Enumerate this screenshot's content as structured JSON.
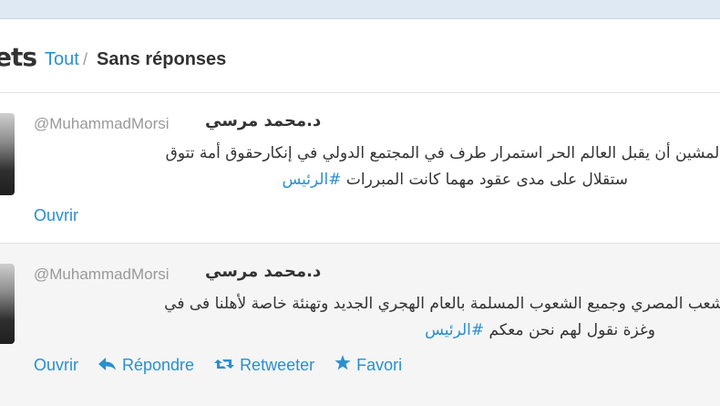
{
  "header": {
    "title_fragment": "ets",
    "tab_all": "Tout",
    "separator": "/",
    "tab_no_replies": "Sans réponses"
  },
  "tweets": [
    {
      "handle": "@MuhammadMorsi",
      "name": "د.محمد مرسي",
      "line1": "المشين أن يقبل العالم الحر استمرار طرف في المجتمع الدولي في إنكارحقوق أمة تتوق",
      "line2": "ستقلال على مدى عقود مهما كانت المبررات",
      "hashtag": "#الرئيس",
      "actions": {
        "open": "Ouvrir"
      }
    },
    {
      "handle": "@MuhammadMorsi",
      "name": "د.محمد مرسي",
      "line1": "شعب المصري وجميع الشعوب المسلمة بالعام الهجري الجديد وتهنئة خاصة لأهلنا فى في",
      "line2": "وغزة نقول لهم نحن معكم",
      "hashtag": "#الرئيس",
      "actions": {
        "open": "Ouvrir",
        "reply": "Répondre",
        "retweet": "Retweeter",
        "favorite": "Favori"
      }
    }
  ],
  "icons": {
    "reply": "reply-arrow-icon",
    "retweet": "retweet-icon",
    "favorite": "star-icon"
  },
  "colors": {
    "link": "#2a8fcf",
    "text": "#333333",
    "muted": "#999999",
    "topbar": "#dfe9f3"
  }
}
